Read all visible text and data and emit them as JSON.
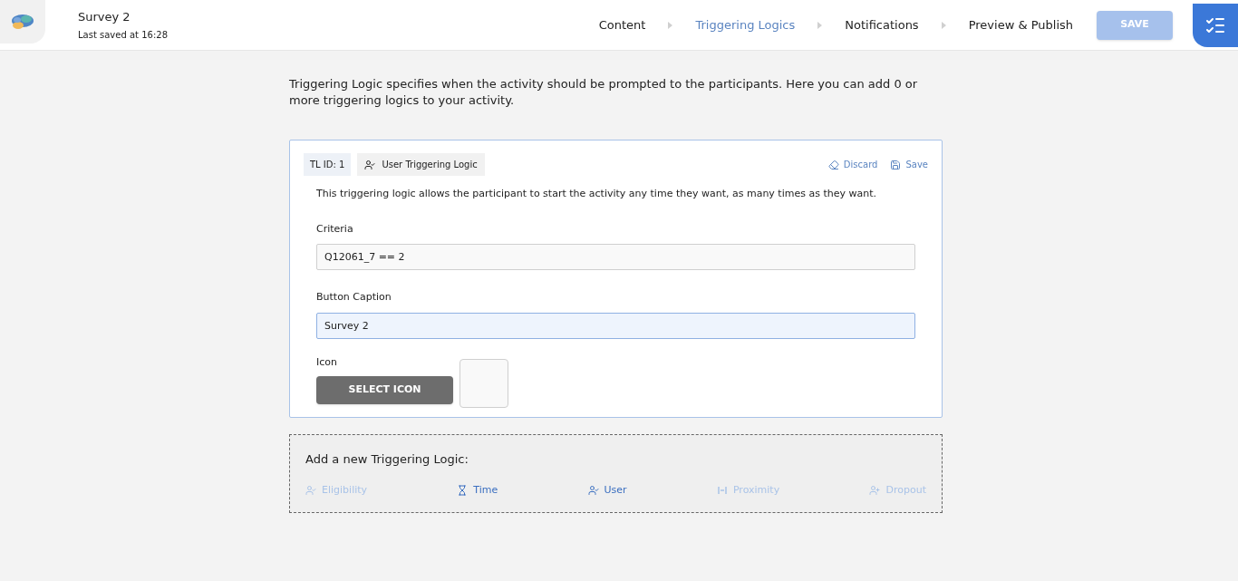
{
  "header": {
    "title": "Survey 2",
    "subtitle": "Last saved at 16:28"
  },
  "steps": [
    {
      "label": "Content",
      "selected": false
    },
    {
      "label": "Triggering Logics",
      "selected": true
    },
    {
      "label": "Notifications",
      "selected": false
    },
    {
      "label": "Preview & Publish",
      "selected": false
    }
  ],
  "save_button": {
    "label": "SAVE",
    "disabled": true
  },
  "intro": "Triggering Logic specifies when the activity should be prompted to the participants. Here you can add 0 or more triggering logics to your activity.",
  "logic_card": {
    "id_badge": "TL ID: 1",
    "type_badge": "User Triggering Logic",
    "actions": [
      {
        "kind": "discard",
        "label": "Discard"
      },
      {
        "kind": "save",
        "label": "Save"
      }
    ],
    "description": "This triggering logic allows the participant to start the activity any time they want, as many times as they want.",
    "fields": [
      {
        "label": "Criteria",
        "value": "Q12061_7 == 2",
        "focused": false
      },
      {
        "label": "Button Caption",
        "value": "Survey 2",
        "focused": true
      }
    ],
    "icon_label": "Icon",
    "select_icon_button": "SELECT ICON"
  },
  "add_panel": {
    "title": "Add a new Triggering Logic:",
    "options": [
      {
        "kind": "eligibility",
        "label": "Eligibility",
        "disabled": true
      },
      {
        "kind": "time",
        "label": "Time",
        "disabled": false
      },
      {
        "kind": "user",
        "label": "User",
        "disabled": false
      },
      {
        "kind": "proximity",
        "label": "Proximity",
        "disabled": true
      },
      {
        "kind": "dropout",
        "label": "Dropout",
        "disabled": true
      }
    ]
  }
}
